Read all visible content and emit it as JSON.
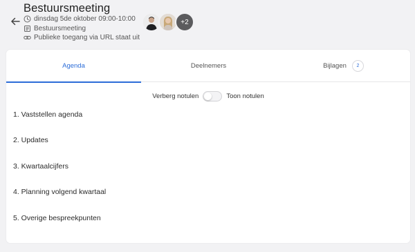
{
  "meeting": {
    "title": "Bestuursmeeting",
    "datetime": "dinsdag 5de oktober 09:00-10:00",
    "board": "Bestuursmeeting",
    "public_access": "Publieke toegang via URL staat uit"
  },
  "participants": {
    "extra_count": "+2"
  },
  "tabs": [
    {
      "label": "Agenda",
      "active": true
    },
    {
      "label": "Deelnemers",
      "active": false
    },
    {
      "label": "Bijlagen",
      "active": false,
      "badge": "2"
    }
  ],
  "notes_toggle": {
    "left_label": "Verberg notulen",
    "right_label": "Toon notulen",
    "on": false
  },
  "agenda": [
    "1. Vaststellen agenda",
    "2. Updates",
    "3. Kwartaalcijfers",
    "4. Planning volgend kwartaal",
    "5. Overige bespreekpunten"
  ],
  "colors": {
    "accent": "#2b6cd8",
    "background": "#f2f2f4",
    "card": "#ffffff"
  },
  "icons": {
    "back": "arrow-left-icon",
    "datetime": "clock-icon",
    "board": "calendar-list-icon",
    "public_access": "link-icon"
  }
}
